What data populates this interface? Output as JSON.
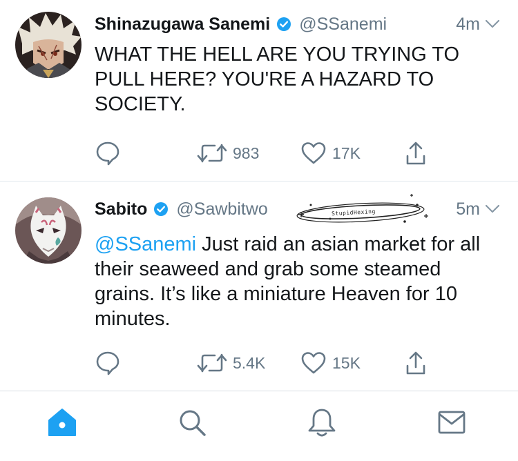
{
  "colors": {
    "text": "#14171a",
    "muted": "#657786",
    "accent": "#1da1f2",
    "divider": "#e1e8ed"
  },
  "tweets": [
    {
      "author_name": "Shinazugawa Sanemi",
      "verified": true,
      "handle": "@SSanemi",
      "time": "4m",
      "text": "WHAT THE HELL ARE YOU TRYING TO PULL HERE? YOU'RE A HAZARD TO SOCIETY.",
      "reply_count": "",
      "retweet_count": "983",
      "like_count": "17K",
      "avatar_icon": "avatar-white-haired-swordsman"
    },
    {
      "author_name": "Sabito",
      "verified": true,
      "handle": "@Sawbitwo",
      "time": "5m",
      "mention": "@SSanemi",
      "text": " Just raid an asian market for all their seaweed and grab some steamed grains. It’s like a miniature Heaven for 10 minutes.",
      "retweet_count": "5.4K",
      "like_count": "15K",
      "avatar_icon": "avatar-fox-mask",
      "watermark": "StupidHexing"
    }
  ],
  "tabbar": {
    "items": [
      {
        "icon": "home-icon",
        "active": true
      },
      {
        "icon": "search-icon",
        "active": false
      },
      {
        "icon": "notifications-icon",
        "active": false
      },
      {
        "icon": "messages-icon",
        "active": false
      }
    ]
  }
}
